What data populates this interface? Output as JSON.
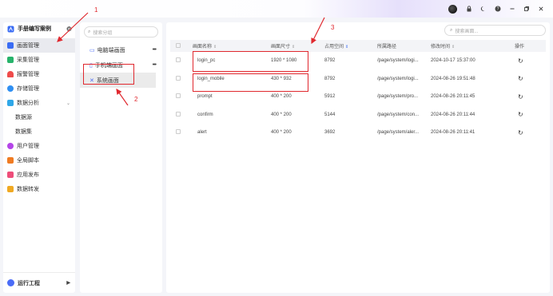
{
  "window": {
    "controls": [
      "avatar",
      "lock-icon",
      "moon-icon",
      "help-icon",
      "minimize-icon",
      "restore-icon",
      "close-icon"
    ]
  },
  "sidebar": {
    "app_title": "手册编写案例",
    "items": [
      {
        "label": "画面管理",
        "icon": "screen-icon",
        "color": "#3a6cf4",
        "active": true
      },
      {
        "label": "采集管理",
        "icon": "collect-icon",
        "color": "#27b36b"
      },
      {
        "label": "报警管理",
        "icon": "bell-icon",
        "color": "#ef4b4b"
      },
      {
        "label": "存储管理",
        "icon": "storage-icon",
        "color": "#2f8ff2"
      },
      {
        "label": "数据分析",
        "icon": "analysis-icon",
        "color": "#2fa7e8"
      },
      {
        "label": "数据源",
        "sub": true
      },
      {
        "label": "数据集",
        "sub": true
      },
      {
        "label": "用户管理",
        "icon": "user-icon",
        "color": "#b445e8"
      },
      {
        "label": "全局脚本",
        "icon": "script-icon",
        "color": "#f07b22"
      },
      {
        "label": "应用发布",
        "icon": "publish-icon",
        "color": "#ee4d7a"
      },
      {
        "label": "数据转发",
        "icon": "forward-icon",
        "color": "#f0a922"
      }
    ],
    "run_project": "运行工程"
  },
  "groups": {
    "search_placeholder": "搜索分组",
    "items": [
      {
        "label": "电脑端画面",
        "icon": "monitor-icon"
      },
      {
        "label": "手机端画面",
        "icon": "phone-icon"
      },
      {
        "label": "系统画面",
        "icon": "system-icon",
        "selected": true
      }
    ]
  },
  "main": {
    "search_placeholder": "搜索画面...",
    "columns": [
      "画面名称",
      "画面尺寸",
      "占用空间",
      "所属路径",
      "修改时间",
      "操作"
    ],
    "rows": [
      {
        "name": "login_pc",
        "size": "1920 * 1080",
        "space": "8792",
        "path": "/page/system/logi...",
        "time": "2024-10-17 15:37:00"
      },
      {
        "name": "login_mobile",
        "size": "430 * 932",
        "space": "8792",
        "path": "/page/system/logi...",
        "time": "2024-08-26 19:51:48"
      },
      {
        "name": "prompt",
        "size": "400 * 200",
        "space": "5912",
        "path": "/page/system/pro...",
        "time": "2024-08-26 20:11:45"
      },
      {
        "name": "confirm",
        "size": "400 * 200",
        "space": "5144",
        "path": "/page/system/con...",
        "time": "2024-08-26 20:11:44"
      },
      {
        "name": "alert",
        "size": "400 * 200",
        "space": "3692",
        "path": "/page/system/aler...",
        "time": "2024-08-26 20:11:41"
      }
    ]
  },
  "annotations": {
    "a1": "1",
    "a2": "2",
    "a3": "3",
    "color": "#e0282e"
  }
}
